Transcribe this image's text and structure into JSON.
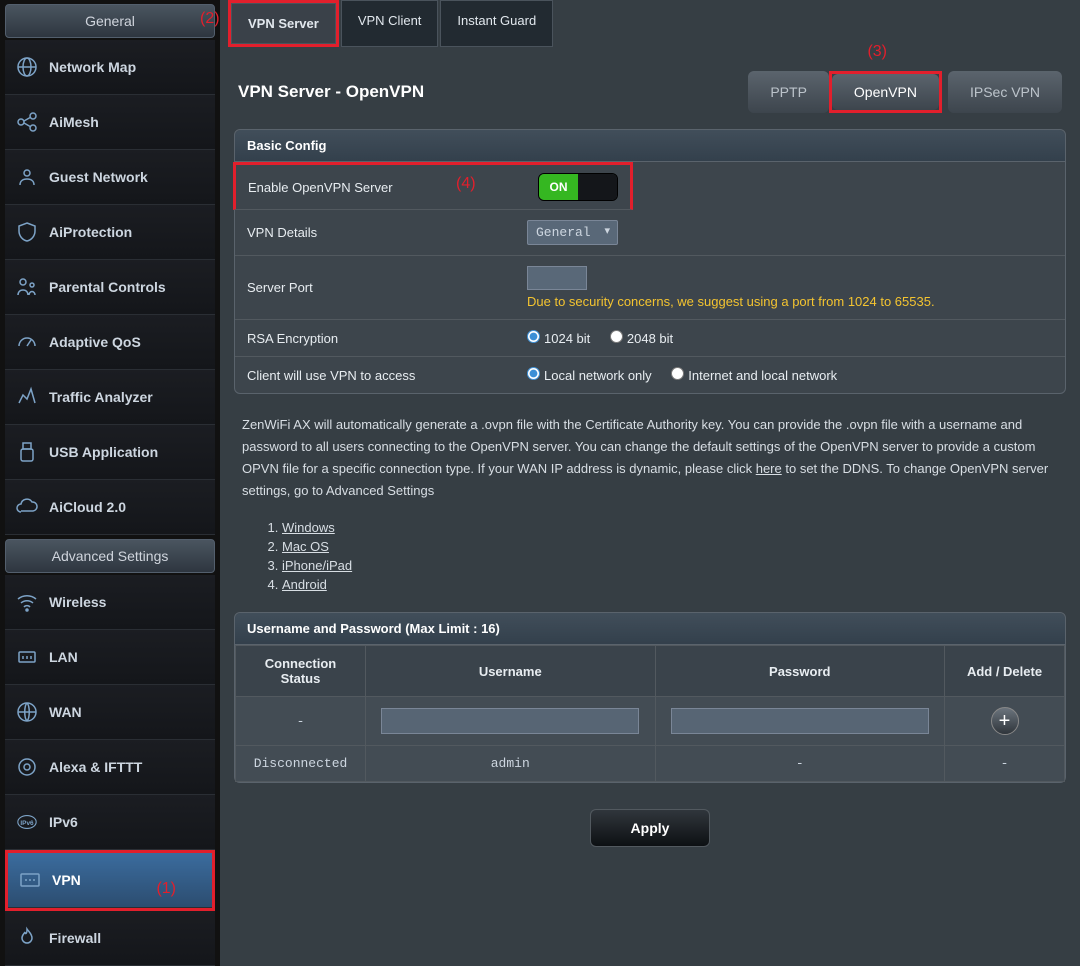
{
  "sidebar": {
    "general_title": "General",
    "advanced_title": "Advanced Settings",
    "general": [
      {
        "label": "Network Map",
        "icon": "globe"
      },
      {
        "label": "AiMesh",
        "icon": "mesh"
      },
      {
        "label": "Guest Network",
        "icon": "guest"
      },
      {
        "label": "AiProtection",
        "icon": "shield"
      },
      {
        "label": "Parental Controls",
        "icon": "family"
      },
      {
        "label": "Adaptive QoS",
        "icon": "gauge"
      },
      {
        "label": "Traffic Analyzer",
        "icon": "traffic"
      },
      {
        "label": "USB Application",
        "icon": "usb"
      },
      {
        "label": "AiCloud 2.0",
        "icon": "cloud"
      }
    ],
    "advanced": [
      {
        "label": "Wireless",
        "icon": "wifi"
      },
      {
        "label": "LAN",
        "icon": "lan"
      },
      {
        "label": "WAN",
        "icon": "wan"
      },
      {
        "label": "Alexa & IFTTT",
        "icon": "alexa"
      },
      {
        "label": "IPv6",
        "icon": "ipv6"
      },
      {
        "label": "VPN",
        "icon": "vpn",
        "selected": true
      },
      {
        "label": "Firewall",
        "icon": "fire"
      }
    ]
  },
  "tabs": [
    {
      "label": "VPN Server",
      "active": true
    },
    {
      "label": "VPN Client"
    },
    {
      "label": "Instant Guard"
    }
  ],
  "page_title": "VPN Server - OpenVPN",
  "vpn_types": [
    {
      "label": "PPTP"
    },
    {
      "label": "OpenVPN",
      "active": true
    },
    {
      "label": "IPSec VPN"
    }
  ],
  "basic_config": {
    "header": "Basic Config",
    "enable_label": "Enable OpenVPN Server",
    "enable_state": "ON",
    "details_label": "VPN Details",
    "details_value": "General",
    "port_label": "Server Port",
    "port_value": "",
    "port_hint": "Due to security concerns, we suggest using a port from 1024 to 65535.",
    "rsa_label": "RSA Encryption",
    "rsa_options": [
      "1024 bit",
      "2048 bit"
    ],
    "access_label": "Client will use VPN to access",
    "access_options": [
      "Local network only",
      "Internet and local network"
    ]
  },
  "info_text": "ZenWiFi AX will automatically generate a .ovpn file with the Certificate Authority key. You can provide the .ovpn file with a username and password to all users connecting to the OpenVPN server. You can change the default settings of the OpenVPN server to provide a custom OPVN file for a specific connection type. If your WAN IP address is dynamic, please click ",
  "info_here": "here",
  "info_text2": " to set the DDNS. To change OpenVPN server settings, go to Advanced Settings",
  "os_list": [
    "Windows",
    "Mac OS",
    "iPhone/iPad",
    "Android"
  ],
  "user_table": {
    "header": "Username and Password (Max Limit : 16)",
    "columns": [
      "Connection Status",
      "Username",
      "Password",
      "Add / Delete"
    ],
    "rows": [
      {
        "status": "-",
        "username": "",
        "password": "",
        "action": "add"
      },
      {
        "status": "Disconnected",
        "username": "admin",
        "password": "-",
        "action": "-"
      }
    ]
  },
  "apply_label": "Apply",
  "markers": {
    "m1": "(1)",
    "m2": "(2)",
    "m3": "(3)",
    "m4": "(4)"
  }
}
